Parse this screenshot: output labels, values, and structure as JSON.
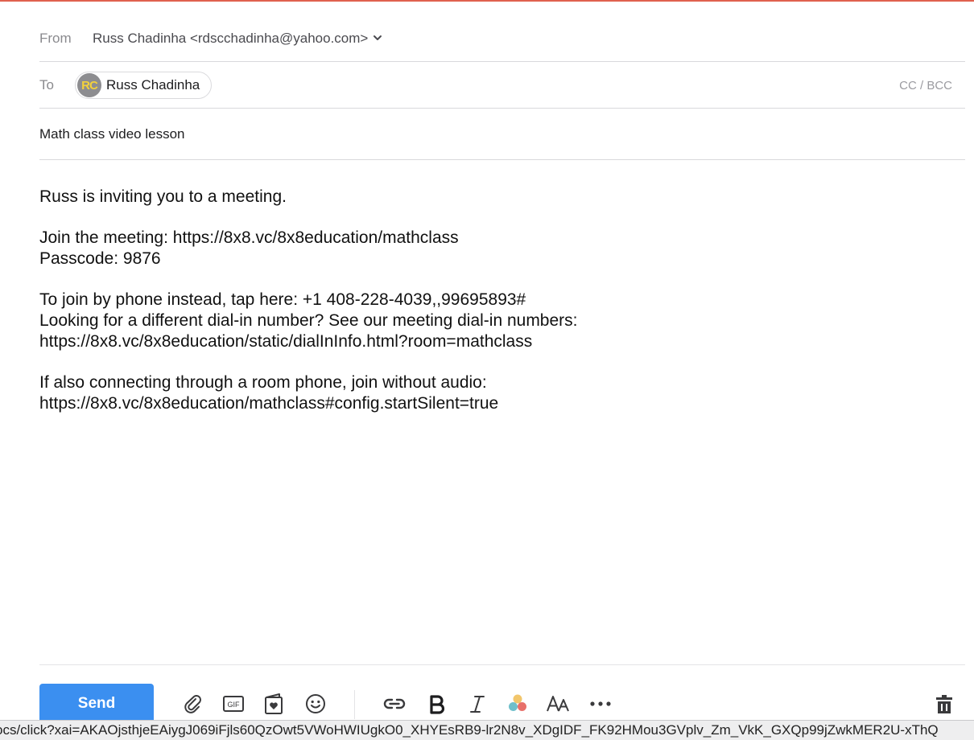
{
  "header": {
    "from_label": "From",
    "from_value": "Russ Chadinha <rdscchadinha@yahoo.com>",
    "to_label": "To",
    "recipient": {
      "initials": "RC",
      "name": "Russ Chadinha"
    },
    "cc_bcc_label": "CC / BCC",
    "subject": "Math class video lesson"
  },
  "body": {
    "lines": [
      "Russ is inviting you to a meeting.",
      "",
      "Join the meeting: https://8x8.vc/8x8education/mathclass",
      "Passcode: 9876",
      "",
      "To join by phone instead, tap here: +1 408-228-4039,,99695893#",
      "Looking for a different dial-in number? See our meeting dial-in numbers:",
      "https://8x8.vc/8x8education/static/dialInInfo.html?room=mathclass",
      "",
      "If also connecting through a room phone, join without audio:",
      "https://8x8.vc/8x8education/mathclass#config.startSilent=true"
    ]
  },
  "toolbar": {
    "send_label": "Send",
    "gif_label": "GIF",
    "tools": [
      "paperclip-icon",
      "gif-icon",
      "stationery-icon",
      "emoji-icon",
      "link-icon",
      "bold-icon",
      "italic-icon",
      "color-icon",
      "font-size-icon",
      "more-icon",
      "trash-icon"
    ]
  },
  "status_bar": {
    "url": "ocs/click?xai=AKAOjsthjeEAiygJ069iFjls60QzOwt5VWoHWIUgkO0_XHYEsRB9-lr2N8v_XDgIDF_FK92HMou3GVplv_Zm_VkK_GXQp99jZwkMER2U-xThQ"
  },
  "colors": {
    "accent": "#3b8ff0",
    "top_border": "#e0614f"
  }
}
